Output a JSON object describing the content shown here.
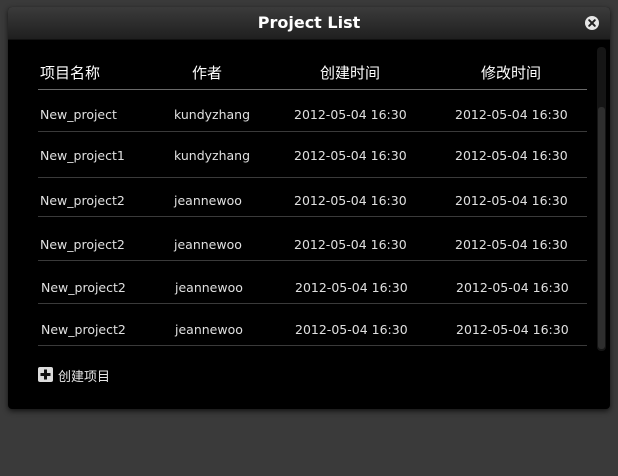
{
  "dialog": {
    "title": "Project List",
    "close_icon": "close-icon"
  },
  "table": {
    "columns": [
      "项目名称",
      "作者",
      "创建时间",
      "修改时间"
    ],
    "rows": [
      {
        "name": "New_project",
        "author": "kundyzhang",
        "created": "2012-05-04 16:30",
        "modified": "2012-05-04 16:30"
      },
      {
        "name": "New_project1",
        "author": "kundyzhang",
        "created": "2012-05-04 16:30",
        "modified": "2012-05-04 16:30"
      },
      {
        "name": "New_project2",
        "author": "jeannewoo",
        "created": "2012-05-04 16:30",
        "modified": "2012-05-04 16:30"
      },
      {
        "name": "New_project2",
        "author": "jeannewoo",
        "created": "2012-05-04 16:30",
        "modified": "2012-05-04 16:30"
      },
      {
        "name": "New_project2",
        "author": "jeannewoo",
        "created": "2012-05-04 16:30",
        "modified": "2012-05-04 16:30"
      },
      {
        "name": "New_project2",
        "author": "jeannewoo",
        "created": "2012-05-04 16:30",
        "modified": "2012-05-04 16:30"
      }
    ]
  },
  "footer": {
    "create_label": "创建项目",
    "create_icon": "plus-icon"
  },
  "colors": {
    "background": "#3a3a3a",
    "dialog": "#000000",
    "text": "#e0e0e0"
  }
}
